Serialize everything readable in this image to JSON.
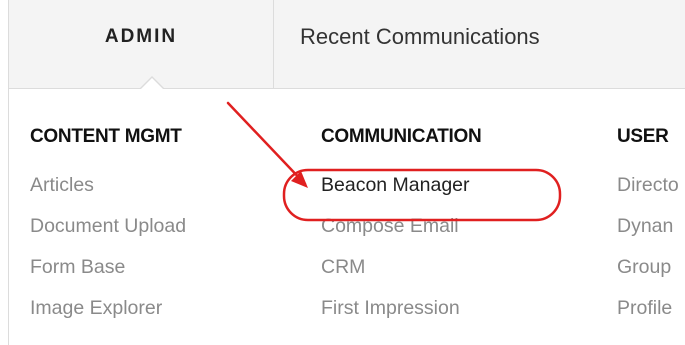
{
  "nav": {
    "tabs": [
      {
        "label": "ADMIN",
        "active": true
      },
      {
        "label": "Recent Communications",
        "active": false
      }
    ]
  },
  "menu": {
    "columns": [
      {
        "heading": "CONTENT MGMT",
        "items": [
          "Articles",
          "Document Upload",
          "Form Base",
          "Image Explorer"
        ]
      },
      {
        "heading": "COMMUNICATION",
        "items": [
          "Beacon Manager",
          "Compose Email",
          "CRM",
          "First Impression"
        ]
      },
      {
        "heading": "USER",
        "items": [
          "Directo",
          "Dynan",
          "Group",
          "Profile"
        ]
      }
    ]
  },
  "annotation": {
    "color": "#e02020",
    "target": "Beacon Manager"
  }
}
